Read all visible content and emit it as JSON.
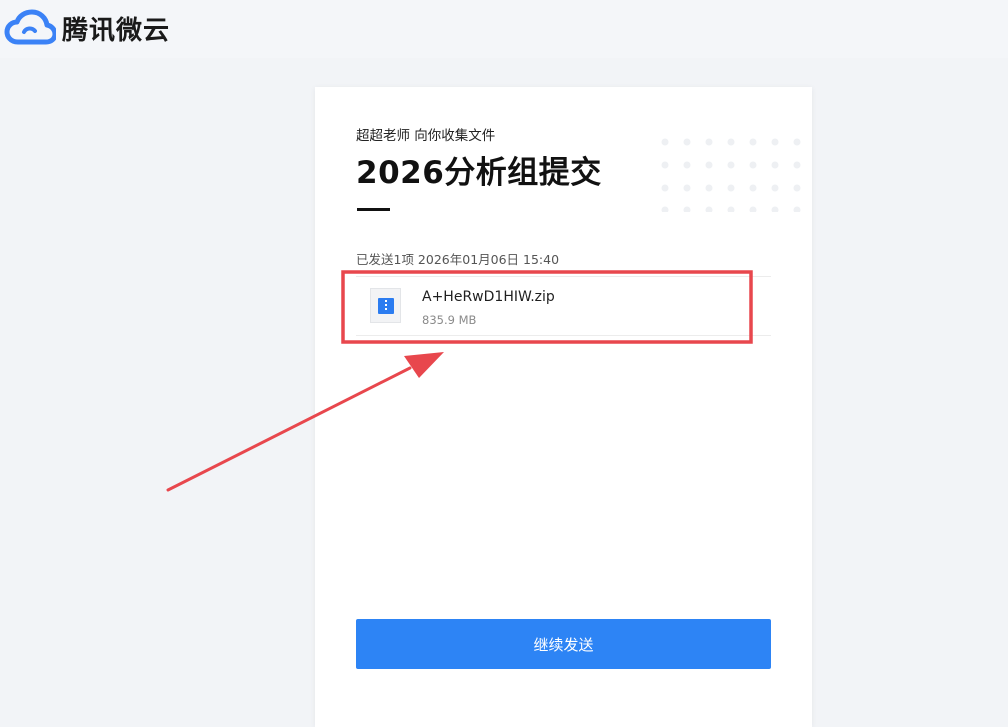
{
  "app": {
    "brand": "腾讯微云",
    "logo_icon": "cloud-icon",
    "brand_color": "#3b82f6"
  },
  "collection": {
    "collector_text": "超超老师 向你收集文件",
    "title": "2026分析组提交",
    "sent_info": "已发送1项 2026年01月06日 15:40"
  },
  "files": [
    {
      "name": "A+HeRwD1HIW.zip",
      "size": "835.9 MB",
      "icon": "zip-file-icon"
    }
  ],
  "actions": {
    "continue_label": "继续发送",
    "button_color": "#2d84f5"
  },
  "annotation": {
    "highlight_color": "#e8474d"
  }
}
